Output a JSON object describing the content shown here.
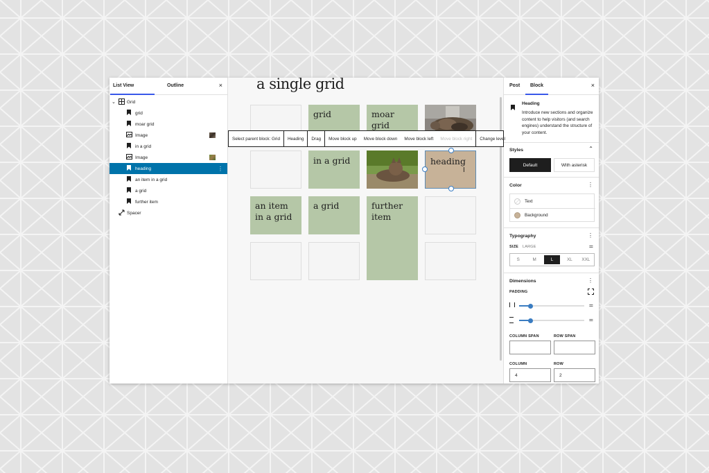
{
  "left_panel": {
    "tabs": [
      "List View",
      "Outline"
    ],
    "close": "×",
    "tree": [
      {
        "label": "Grid",
        "icon": "grid-icon"
      },
      {
        "label": "grid",
        "icon": "bookmark-icon"
      },
      {
        "label": "moar grid",
        "icon": "bookmark-icon"
      },
      {
        "label": "Image",
        "icon": "image-icon"
      },
      {
        "label": "in a grid",
        "icon": "bookmark-icon"
      },
      {
        "label": "Image",
        "icon": "image-icon"
      },
      {
        "label": "heading",
        "icon": "bookmark-icon"
      },
      {
        "label": "an item in a grid",
        "icon": "bookmark-icon"
      },
      {
        "label": "a grid",
        "icon": "bookmark-icon"
      },
      {
        "label": "further item",
        "icon": "bookmark-icon"
      },
      {
        "label": "Spacer",
        "icon": "resize-icon"
      }
    ]
  },
  "canvas": {
    "title": "a single grid",
    "cells": {
      "grid": "grid",
      "moar_grid": "moar grid",
      "in_a_grid": "in a grid",
      "heading": "heading",
      "an_item": "an item in a grid",
      "a_grid": "a grid",
      "further_item": "further item"
    }
  },
  "toolbar": {
    "items": [
      "Select parent block: Grid",
      "Heading",
      "Drag",
      "Move block up",
      "Move block down",
      "Move block left",
      "Move block right",
      "Change level"
    ]
  },
  "right_panel": {
    "tabs": [
      "Post",
      "Block"
    ],
    "close": "×",
    "block_name": "Heading",
    "block_description": "Introduce new sections and organize content to help visitors (and search engines) understand the structure of your content.",
    "styles": {
      "title": "Styles",
      "options": [
        "Default",
        "With asterisk"
      ]
    },
    "color": {
      "title": "Color",
      "items": [
        "Text",
        "Background"
      ],
      "background_color": "#c7b298"
    },
    "typography": {
      "title": "Typography",
      "size_label": "SIZE",
      "size_value": "LARGE",
      "sizes": [
        "S",
        "M",
        "L",
        "XL",
        "XXL"
      ],
      "selected": "L"
    },
    "dimensions": {
      "title": "Dimensions",
      "padding_label": "PADDING",
      "column_span_label": "COLUMN SPAN",
      "row_span_label": "ROW SPAN",
      "column_label": "COLUMN",
      "row_label": "ROW",
      "column_value": "4",
      "row_value": "2"
    }
  },
  "colors": {
    "accent": "#0073aa",
    "cell_green": "#b5c7a7",
    "cell_tan": "#c7b298"
  }
}
